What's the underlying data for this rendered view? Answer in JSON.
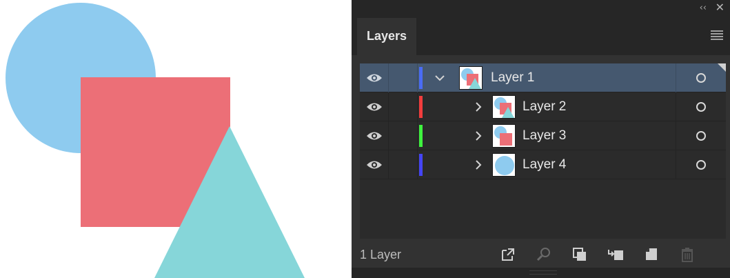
{
  "canvas": {
    "shapes": [
      {
        "kind": "circle",
        "color": "#8ecbef"
      },
      {
        "kind": "square",
        "color": "#ec6f77"
      },
      {
        "kind": "triangle",
        "color": "#86d6d9"
      }
    ]
  },
  "panel": {
    "collapse_glyph": "‹‹",
    "close_glyph": "✕",
    "tab_label": "Layers",
    "layers": [
      {
        "name": "Layer 1",
        "expanded": true,
        "selected": true,
        "color": "#4a6cf5",
        "thumb": "composite"
      },
      {
        "name": "Layer 2",
        "expanded": false,
        "selected": false,
        "color": "#f23d3d",
        "thumb": "square"
      },
      {
        "name": "Layer 3",
        "expanded": false,
        "selected": false,
        "color": "#3ff23f",
        "thumb": "square-circle"
      },
      {
        "name": "Layer 4",
        "expanded": false,
        "selected": false,
        "color": "#4545f5",
        "thumb": "circle"
      }
    ],
    "footer": {
      "layer_count": "1 Layer",
      "icons": [
        "export-icon",
        "locate-object-icon",
        "clipping-mask-icon",
        "new-sublayer-icon",
        "new-layer-icon",
        "trash-icon"
      ]
    }
  }
}
